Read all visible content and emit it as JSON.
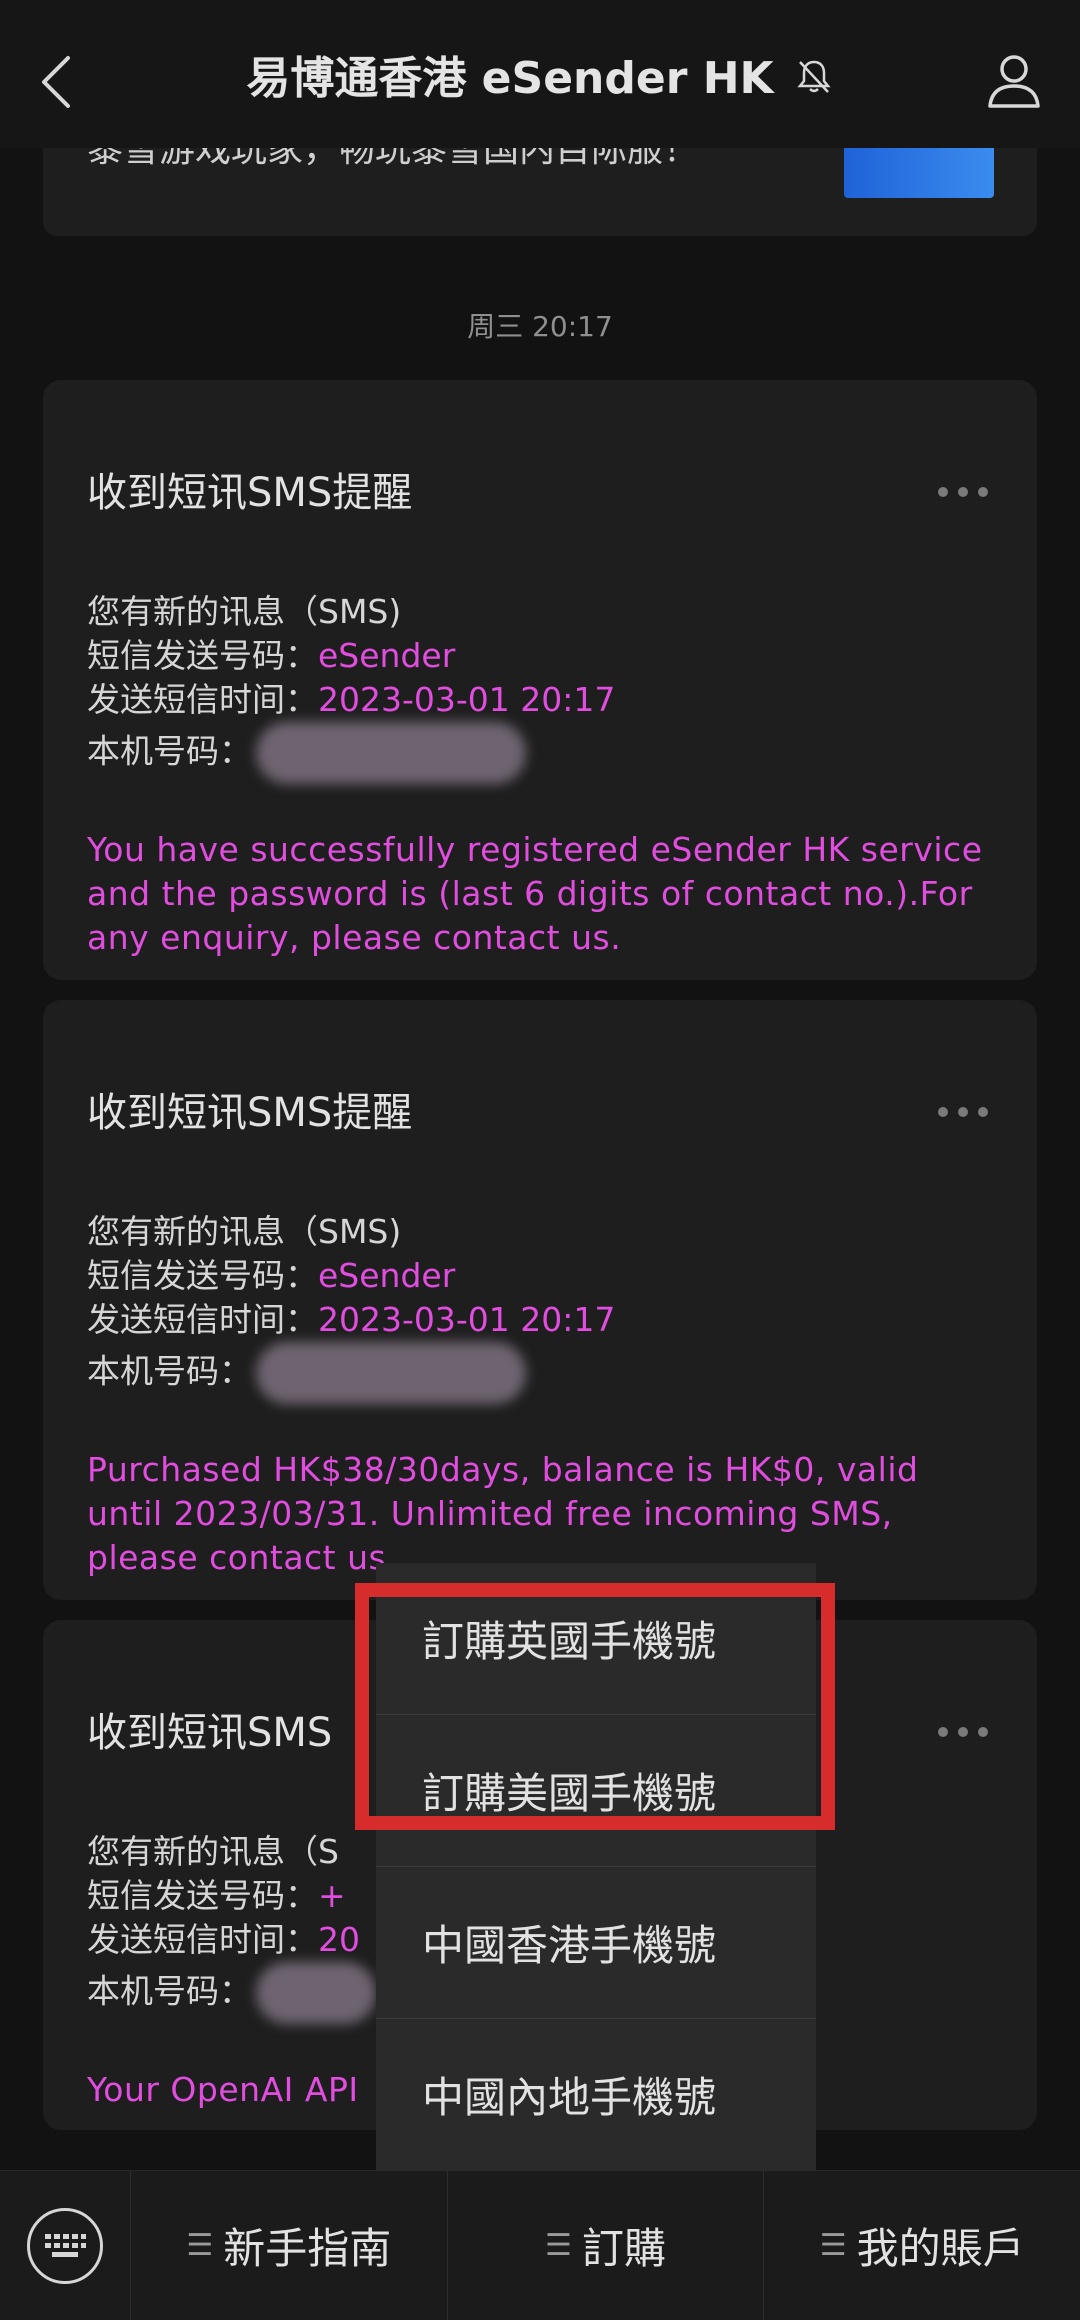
{
  "header": {
    "title": "易博通香港 eSender HK",
    "back_icon": "back-arrow-icon",
    "mute_icon": "bell-off-icon",
    "profile_icon": "person-icon"
  },
  "top_card": {
    "text": "黍雪游戏玩家，畅玩黍雪国内目际服！"
  },
  "timestamp": "周三 20:17",
  "cards": [
    {
      "title": "收到短讯SMS提醒",
      "line1": "您有新的讯息（SMS)",
      "sender_label": "短信发送号码：",
      "sender_value": "eSender",
      "time_label": "发送短信时间：",
      "time_value": "2023-03-01 20:17",
      "phone_label": "本机号码：",
      "message": "You have successfully registered eSender HK service and the password is (last 6 digits of contact no.).For any enquiry, please contact us."
    },
    {
      "title": "收到短讯SMS提醒",
      "line1": "您有新的讯息（SMS)",
      "sender_label": "短信发送号码：",
      "sender_value": "eSender",
      "time_label": "发送短信时间：",
      "time_value": "2023-03-01 20:17",
      "phone_label": "本机号码：",
      "message": "Purchased HK$38/30days, balance is HK$0, valid until 2023/03/31. Unlimited free incoming SMS,  please contact us."
    },
    {
      "title": "收到短讯SMS",
      "line1": "您有新的讯息（S",
      "sender_label": "短信发送号码：",
      "sender_value": "+",
      "time_label": "发送短信时间：",
      "time_value": "20",
      "phone_label": "本机号码：",
      "message": "Your OpenAI API"
    }
  ],
  "popup_menu": {
    "items": [
      "訂購英國手機號",
      "訂購美國手機號",
      "中國香港手機號",
      "中國內地手機號"
    ]
  },
  "bottom_nav": {
    "keyboard_icon": "keyboard-icon",
    "items": [
      "新手指南",
      "訂購",
      "我的賬戶"
    ]
  },
  "colors": {
    "background": "#121212",
    "card": "#1e1e1e",
    "accent_text": "#e14ddf",
    "highlight_box": "#d62c2c"
  }
}
